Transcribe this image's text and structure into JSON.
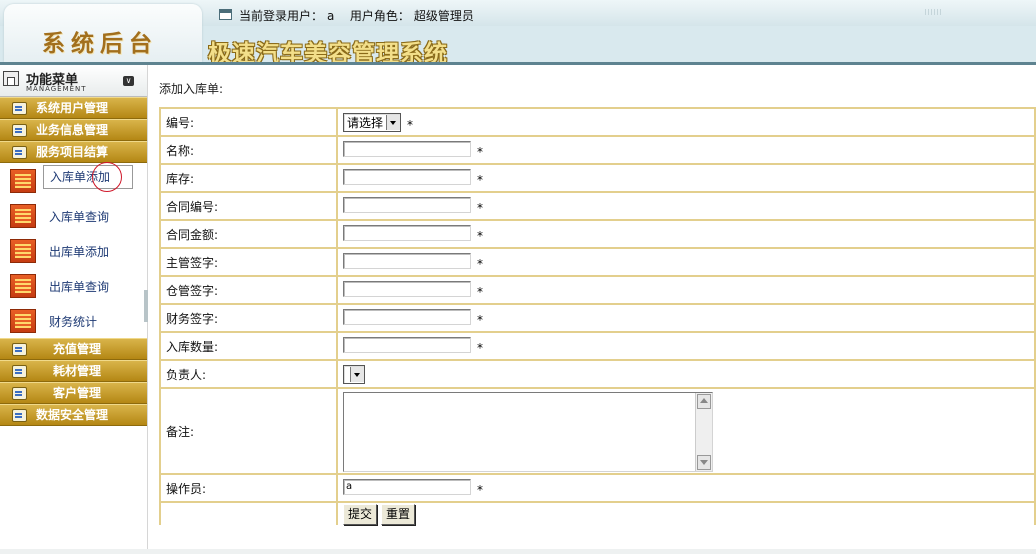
{
  "header": {
    "brand": "系统后台",
    "system_title": "极速汽车美容管理系统",
    "user_label": "当前登录用户：",
    "user_value": "a",
    "role_label": "用户角色：",
    "role_value": "超级管理员"
  },
  "sidebar": {
    "title": "功能菜单",
    "subtitle": "MANAGEMENT",
    "categories_top": [
      {
        "label": "系统用户管理"
      },
      {
        "label": "业务信息管理"
      },
      {
        "label": "服务项目结算"
      }
    ],
    "sub_items": [
      {
        "label": "入库单添加",
        "active": true
      },
      {
        "label": "入库单查询"
      },
      {
        "label": "出库单添加"
      },
      {
        "label": "出库单查询"
      },
      {
        "label": "财务统计"
      }
    ],
    "categories_bottom": [
      {
        "label": "充值管理"
      },
      {
        "label": "耗材管理"
      },
      {
        "label": "客户管理"
      },
      {
        "label": "数据安全管理"
      }
    ]
  },
  "main": {
    "page_title": "添加入库单:",
    "required_mark": "*",
    "fields": {
      "number": {
        "label": "编号:",
        "selected": "请选择"
      },
      "name": {
        "label": "名称:",
        "value": ""
      },
      "stock": {
        "label": "库存:",
        "value": ""
      },
      "contract_no": {
        "label": "合同编号:",
        "value": ""
      },
      "contract_amount": {
        "label": "合同金额:",
        "value": ""
      },
      "supervisor_sign": {
        "label": "主管签字:",
        "value": ""
      },
      "warehouse_sign": {
        "label": "仓管签字:",
        "value": ""
      },
      "finance_sign": {
        "label": "财务签字:",
        "value": ""
      },
      "quantity": {
        "label": "入库数量:",
        "value": ""
      },
      "person_in_charge": {
        "label": "负责人:",
        "selected": ""
      },
      "remarks": {
        "label": "备注:",
        "value": ""
      },
      "operator": {
        "label": "操作员:",
        "value": "a"
      }
    },
    "buttons": {
      "submit": "提交",
      "reset": "重置"
    }
  }
}
